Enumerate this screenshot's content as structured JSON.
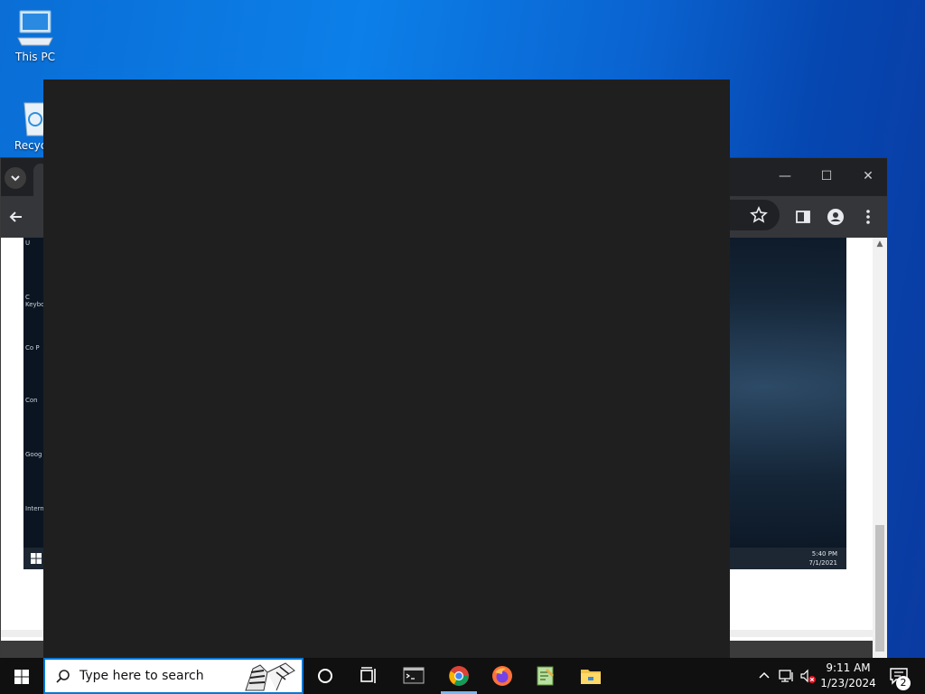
{
  "desktop": {
    "icons": [
      {
        "label": "This PC",
        "icon": "computer-icon"
      },
      {
        "label": "Recycle",
        "icon": "recycle-bin-icon"
      }
    ]
  },
  "chrome": {
    "tab_dropdown_icon": "chevron-down-icon",
    "window_controls": {
      "minimize": "—",
      "maximize": "☐",
      "close": "✕"
    },
    "toolbar_icons": [
      "back-arrow-icon",
      "star-icon",
      "side-panel-icon",
      "profile-icon",
      "menu-dots-icon"
    ],
    "inner_screenshot": {
      "sidebar_labels": [
        "U",
        "C\nKeybo",
        "Co\nP",
        "Con",
        "Goog",
        "Intern"
      ],
      "clock_time": "5:40 PM",
      "clock_date": "7/1/2021"
    }
  },
  "taskbar": {
    "search_placeholder": "Type here to search",
    "apps": [
      "cortana-icon",
      "task-view-icon",
      "terminal-icon",
      "chrome-icon",
      "firefox-icon",
      "notepad-icon",
      "file-explorer-icon"
    ],
    "clock_time": "9:11 AM",
    "clock_date": "1/23/2024",
    "notification_count": "2"
  }
}
